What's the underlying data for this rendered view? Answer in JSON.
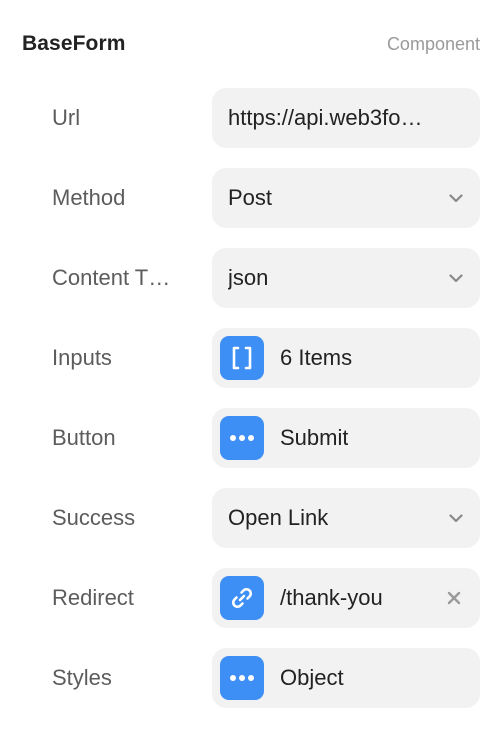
{
  "header": {
    "title": "BaseForm",
    "subtitle": "Component"
  },
  "accent_color": "#3d8ef5",
  "rows": [
    {
      "label": "Url",
      "value": "https://api.web3fo…",
      "kind": "text"
    },
    {
      "label": "Method",
      "value": "Post",
      "kind": "select"
    },
    {
      "label": "Content T…",
      "value": "json",
      "kind": "select"
    },
    {
      "label": "Inputs",
      "value": "6 Items",
      "kind": "array",
      "icon": "brackets-icon"
    },
    {
      "label": "Button",
      "value": "Submit",
      "kind": "object",
      "icon": "ellipsis-icon"
    },
    {
      "label": "Success",
      "value": "Open Link",
      "kind": "select"
    },
    {
      "label": "Redirect",
      "value": "/thank-you",
      "kind": "link",
      "icon": "link-icon"
    },
    {
      "label": "Styles",
      "value": "Object",
      "kind": "object",
      "icon": "ellipsis-icon"
    }
  ]
}
